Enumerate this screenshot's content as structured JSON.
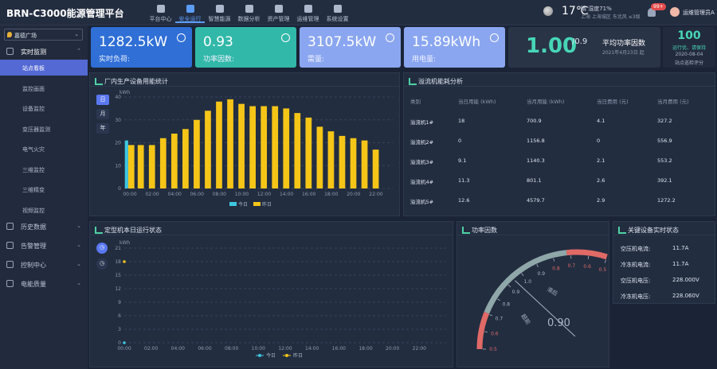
{
  "app": {
    "title": "BRN-C3000能源管理平台"
  },
  "nav": [
    {
      "label": "平台中心",
      "icon": "home-icon"
    },
    {
      "label": "安全运行",
      "icon": "shield-icon",
      "active": true
    },
    {
      "label": "智慧能源",
      "icon": "leaf-icon"
    },
    {
      "label": "数据分析",
      "icon": "chart-icon"
    },
    {
      "label": "资产管理",
      "icon": "database-icon"
    },
    {
      "label": "运维管理",
      "icon": "wrench-icon"
    },
    {
      "label": "系统设置",
      "icon": "gear-icon"
    }
  ],
  "weather": {
    "temp": "17℃",
    "line1": "晴  湿度71%",
    "line2": "上海  上海城区  东北风  ≤3级"
  },
  "user": {
    "badge": "99+",
    "name": "运维管理员A"
  },
  "sidebar": {
    "location": "嘉德广场",
    "groups": [
      {
        "label": "实时监测",
        "open": true,
        "items": [
          "站点看板",
          "监控画面",
          "设备监控",
          "变压器监测",
          "电气火灾",
          "三维监控",
          "三维精变",
          "视频监控"
        ],
        "active_index": 0
      },
      {
        "label": "历史数据"
      },
      {
        "label": "告警管理"
      },
      {
        "label": "控制中心"
      },
      {
        "label": "电能质量"
      }
    ]
  },
  "kpis": [
    {
      "value": "1282.5kW",
      "label": "实时负荷:",
      "color": "#2f6fd6"
    },
    {
      "value": "0.93",
      "label": "功率因数:",
      "color": "#31b8a8"
    },
    {
      "value": "3107.5kW",
      "label": "需量:",
      "color": "#8ba6f0"
    },
    {
      "value": "15.89kWh",
      "label": "用电量:",
      "color": "#8ba6f0"
    }
  ],
  "pf_card": {
    "value": "1.00",
    "target": "/0.9",
    "label": "平均功率因数",
    "date": "2021年4月23日 起"
  },
  "score_card": {
    "value": "100",
    "status": "运行优、请保持",
    "date": "2020-08-04",
    "label": "站点巡检评分"
  },
  "energy_panel": {
    "title": "厂内生产设备用能统计",
    "tabs": [
      "日",
      "月",
      "年"
    ],
    "active_tab": 0
  },
  "runtime_panel": {
    "title": "定型机本日运行状态"
  },
  "table_panel": {
    "title": "溢流机能耗分析",
    "headers": [
      "类别",
      "当日用能 (kWh)",
      "当月用能 (kWh)",
      "当日费用 (元)",
      "当月费用 (元)"
    ],
    "rows": [
      [
        "溢流机1#",
        "18",
        "700.9",
        "4.1",
        "327.2"
      ],
      [
        "溢流机2#",
        "0",
        "1156.8",
        "0",
        "556.9"
      ],
      [
        "溢流机3#",
        "9.1",
        "1140.3",
        "2.1",
        "553.2"
      ],
      [
        "溢流机4#",
        "11.3",
        "801.1",
        "2.6",
        "392.1"
      ],
      [
        "溢流机5#",
        "12.6",
        "4579.7",
        "2.9",
        "1272.2"
      ]
    ]
  },
  "gauge_panel": {
    "title": "功率因数",
    "value": "0.90",
    "lead": "超前",
    "lag": "滞后",
    "ticks_left": [
      "0.5",
      "0.6",
      "0.7",
      "0.8",
      "0.9",
      "1.0"
    ],
    "ticks_right": [
      "0.9",
      "0.8",
      "0.7",
      "0.6",
      "0.5"
    ]
  },
  "status_panel": {
    "title": "关键设备实时状态",
    "items": [
      {
        "label": "空压机电流:",
        "value": "11.7A"
      },
      {
        "label": "冷冻机电流:",
        "value": "11.7A"
      },
      {
        "label": "空压机电压:",
        "value": "228.000V"
      },
      {
        "label": "冷冻机电压:",
        "value": "228.060V"
      }
    ]
  },
  "chart_data": [
    {
      "type": "bar",
      "unit": "kWh",
      "categories": [
        "00:00",
        "01:00",
        "02:00",
        "03:00",
        "04:00",
        "05:00",
        "06:00",
        "07:00",
        "08:00",
        "09:00",
        "10:00",
        "11:00",
        "12:00",
        "13:00",
        "14:00",
        "15:00",
        "16:00",
        "17:00",
        "18:00",
        "19:00",
        "20:00",
        "21:00",
        "22:00",
        "23:00"
      ],
      "x_tick_labels": [
        "00:00",
        "02:00",
        "04:00",
        "06:00",
        "08:00",
        "10:00",
        "12:00",
        "14:00",
        "16:00",
        "18:00",
        "20:00",
        "22:00"
      ],
      "series": [
        {
          "name": "今日",
          "color": "#3ec6e0",
          "values": [
            21,
            null,
            null,
            null,
            null,
            null,
            null,
            null,
            null,
            null,
            null,
            null,
            null,
            null,
            null,
            null,
            null,
            null,
            null,
            null,
            null,
            null,
            null,
            null
          ]
        },
        {
          "name": "昨日",
          "color": "#f5c518",
          "values": [
            19,
            19,
            19,
            22,
            24,
            26,
            30,
            34,
            38,
            39,
            37,
            36,
            36,
            36,
            35,
            33,
            31,
            27,
            25,
            23,
            22,
            21,
            17,
            null
          ]
        }
      ],
      "ylim": [
        0,
        40
      ],
      "yticks": [
        0,
        10,
        20,
        30,
        40
      ],
      "grid": true,
      "legend": "bottom"
    },
    {
      "type": "line",
      "unit": "kWh",
      "x_tick_labels": [
        "00:00",
        "02:00",
        "04:00",
        "06:00",
        "08:00",
        "10:00",
        "12:00",
        "14:00",
        "16:00",
        "18:00",
        "20:00",
        "22:00"
      ],
      "series": [
        {
          "name": "今日",
          "color": "#3ec6e0",
          "values": [
            0
          ]
        },
        {
          "name": "昨日",
          "color": "#f5c518",
          "values": [
            18
          ]
        }
      ],
      "ylim": [
        0,
        21
      ],
      "yticks": [
        0,
        3,
        6,
        9,
        12,
        15,
        18,
        21
      ],
      "grid": true,
      "legend": "bottom"
    }
  ]
}
